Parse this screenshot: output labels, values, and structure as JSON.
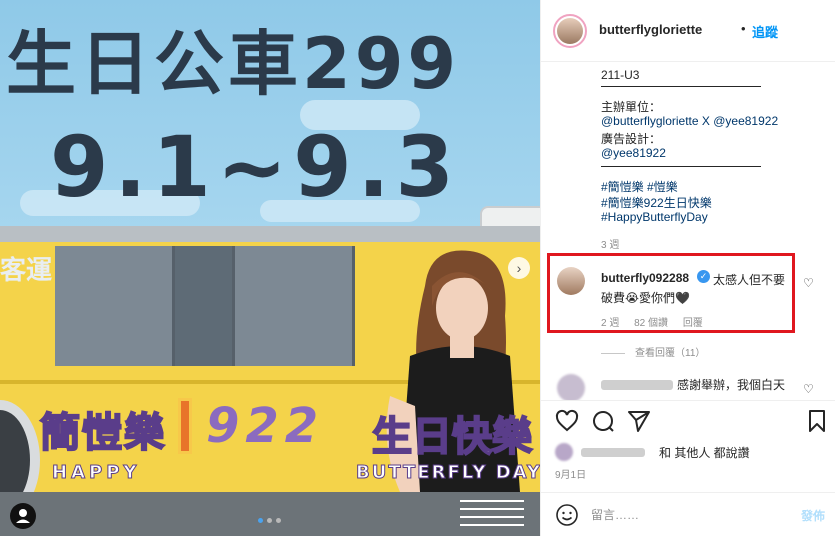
{
  "media": {
    "headline_line1": "生日公車299",
    "headline_line2": "9.1~9.3",
    "bus_company": "客運",
    "bus_name": "簡愷樂",
    "bus_number": "922",
    "bus_birthday": "生日快樂",
    "bus_happy": "HAPPY",
    "bus_butterfly": "BUTTERFLY DAY",
    "next_arrow": "›",
    "carousel_dots": 3,
    "carousel_active_index": 0
  },
  "header": {
    "username": "butterflygloriette",
    "separator": "•",
    "follow_label": "追蹤"
  },
  "caption": {
    "lines": [
      {
        "text": "211-U3",
        "link": false
      },
      {
        "text": "主辦單位：",
        "link": false
      },
      {
        "text": "@butterflygloriette X @yee81922",
        "link": true
      },
      {
        "text": "廣告設計：",
        "link": false
      },
      {
        "text": "@yee81922",
        "link": true
      },
      {
        "text": "#簡愷樂 #愷樂",
        "link": true
      },
      {
        "text": "#簡愷樂922生日快樂",
        "link": true
      },
      {
        "text": "#HappyButterflyDay",
        "link": true
      }
    ],
    "time": "3 週"
  },
  "highlighted_comment": {
    "username": "butterfly092288",
    "verified_mark": "✓",
    "text_line1": "太感人但不要",
    "text_line2": "破費😭愛你們🖤",
    "time": "2 週",
    "likes": "82 個讚",
    "reply_label": "回覆",
    "heart": "♡"
  },
  "view_replies": "查看回覆（11）",
  "second_comment": {
    "text": "感謝舉辦，我個白天",
    "heart": "♡"
  },
  "likes_text": "和 其他人 都說讚",
  "post_date": "9月1日",
  "comment_box": {
    "placeholder": "留言……",
    "post_label": "發佈"
  },
  "colors": {
    "link": "#00376b",
    "follow": "#0095f6",
    "highlight_border": "#e0171f",
    "bus_yellow": "#f4d34a",
    "headline": "#2b3a4a",
    "sky": "#8fc9e8"
  }
}
